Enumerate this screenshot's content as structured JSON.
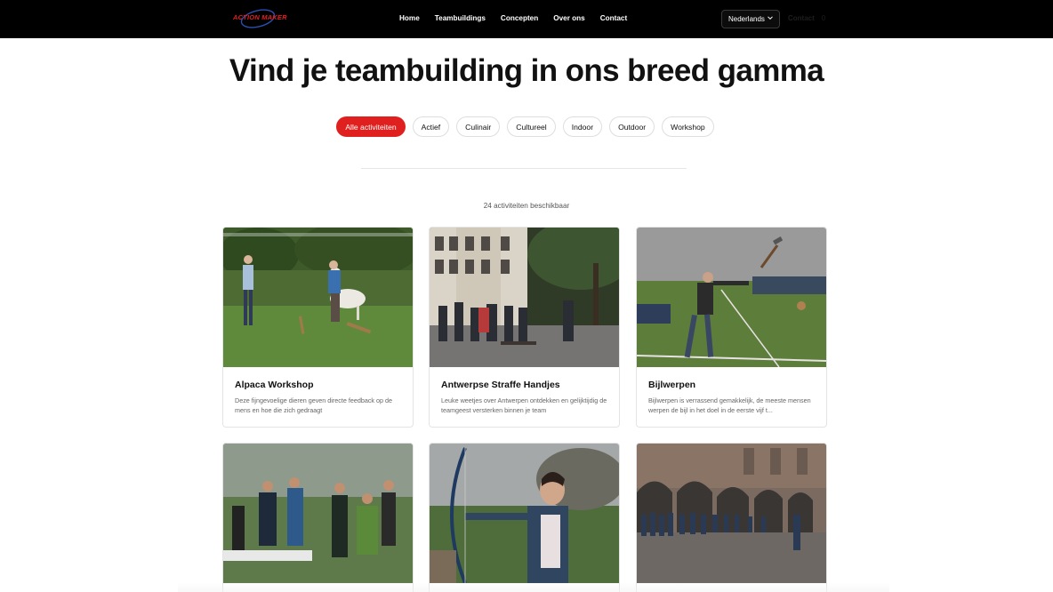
{
  "brand": {
    "logo_text": "ACTION MAKER"
  },
  "nav": {
    "items": [
      "Home",
      "Teambuildings",
      "Concepten",
      "Over ons",
      "Contact"
    ],
    "language": "Nederlands",
    "ghost_text": "Contact",
    "ghost_count": "0"
  },
  "hero": {
    "title": "Vind je teambuilding in ons breed gamma"
  },
  "filters": {
    "active": "Alle activiteiten",
    "options": [
      "Alle activiteiten",
      "Actief",
      "Culinair",
      "Cultureel",
      "Indoor",
      "Outdoor",
      "Workshop"
    ]
  },
  "results": {
    "count_text": "24 activiteiten beschikbaar"
  },
  "activities": [
    {
      "title": "Alpaca Workshop",
      "description": "Deze fijngevoelige dieren geven directe feedback op de mens en hoe die zich gedraagt",
      "image": "alpaca-workshop-photo"
    },
    {
      "title": "Antwerpse Straffe Handjes",
      "description": "Leuke weetjes over Antwerpen ontdekken en gelijktijdig de teamgeest versterken binnen je team",
      "image": "antwerp-street-group-photo"
    },
    {
      "title": "Bijlwerpen",
      "description": "Bijlwerpen is verrassend gemakkelijk, de meeste mensen werpen de bijl in het doel in de eerste vijf t...",
      "image": "axe-throwing-photo"
    },
    {
      "title": "",
      "description": "",
      "image": "outdoor-group-activity-photo"
    },
    {
      "title": "",
      "description": "",
      "image": "archery-photo"
    },
    {
      "title": "",
      "description": "",
      "image": "historic-courtyard-group-photo"
    }
  ],
  "colors": {
    "accent": "#e0201f",
    "topbar": "#000000"
  }
}
